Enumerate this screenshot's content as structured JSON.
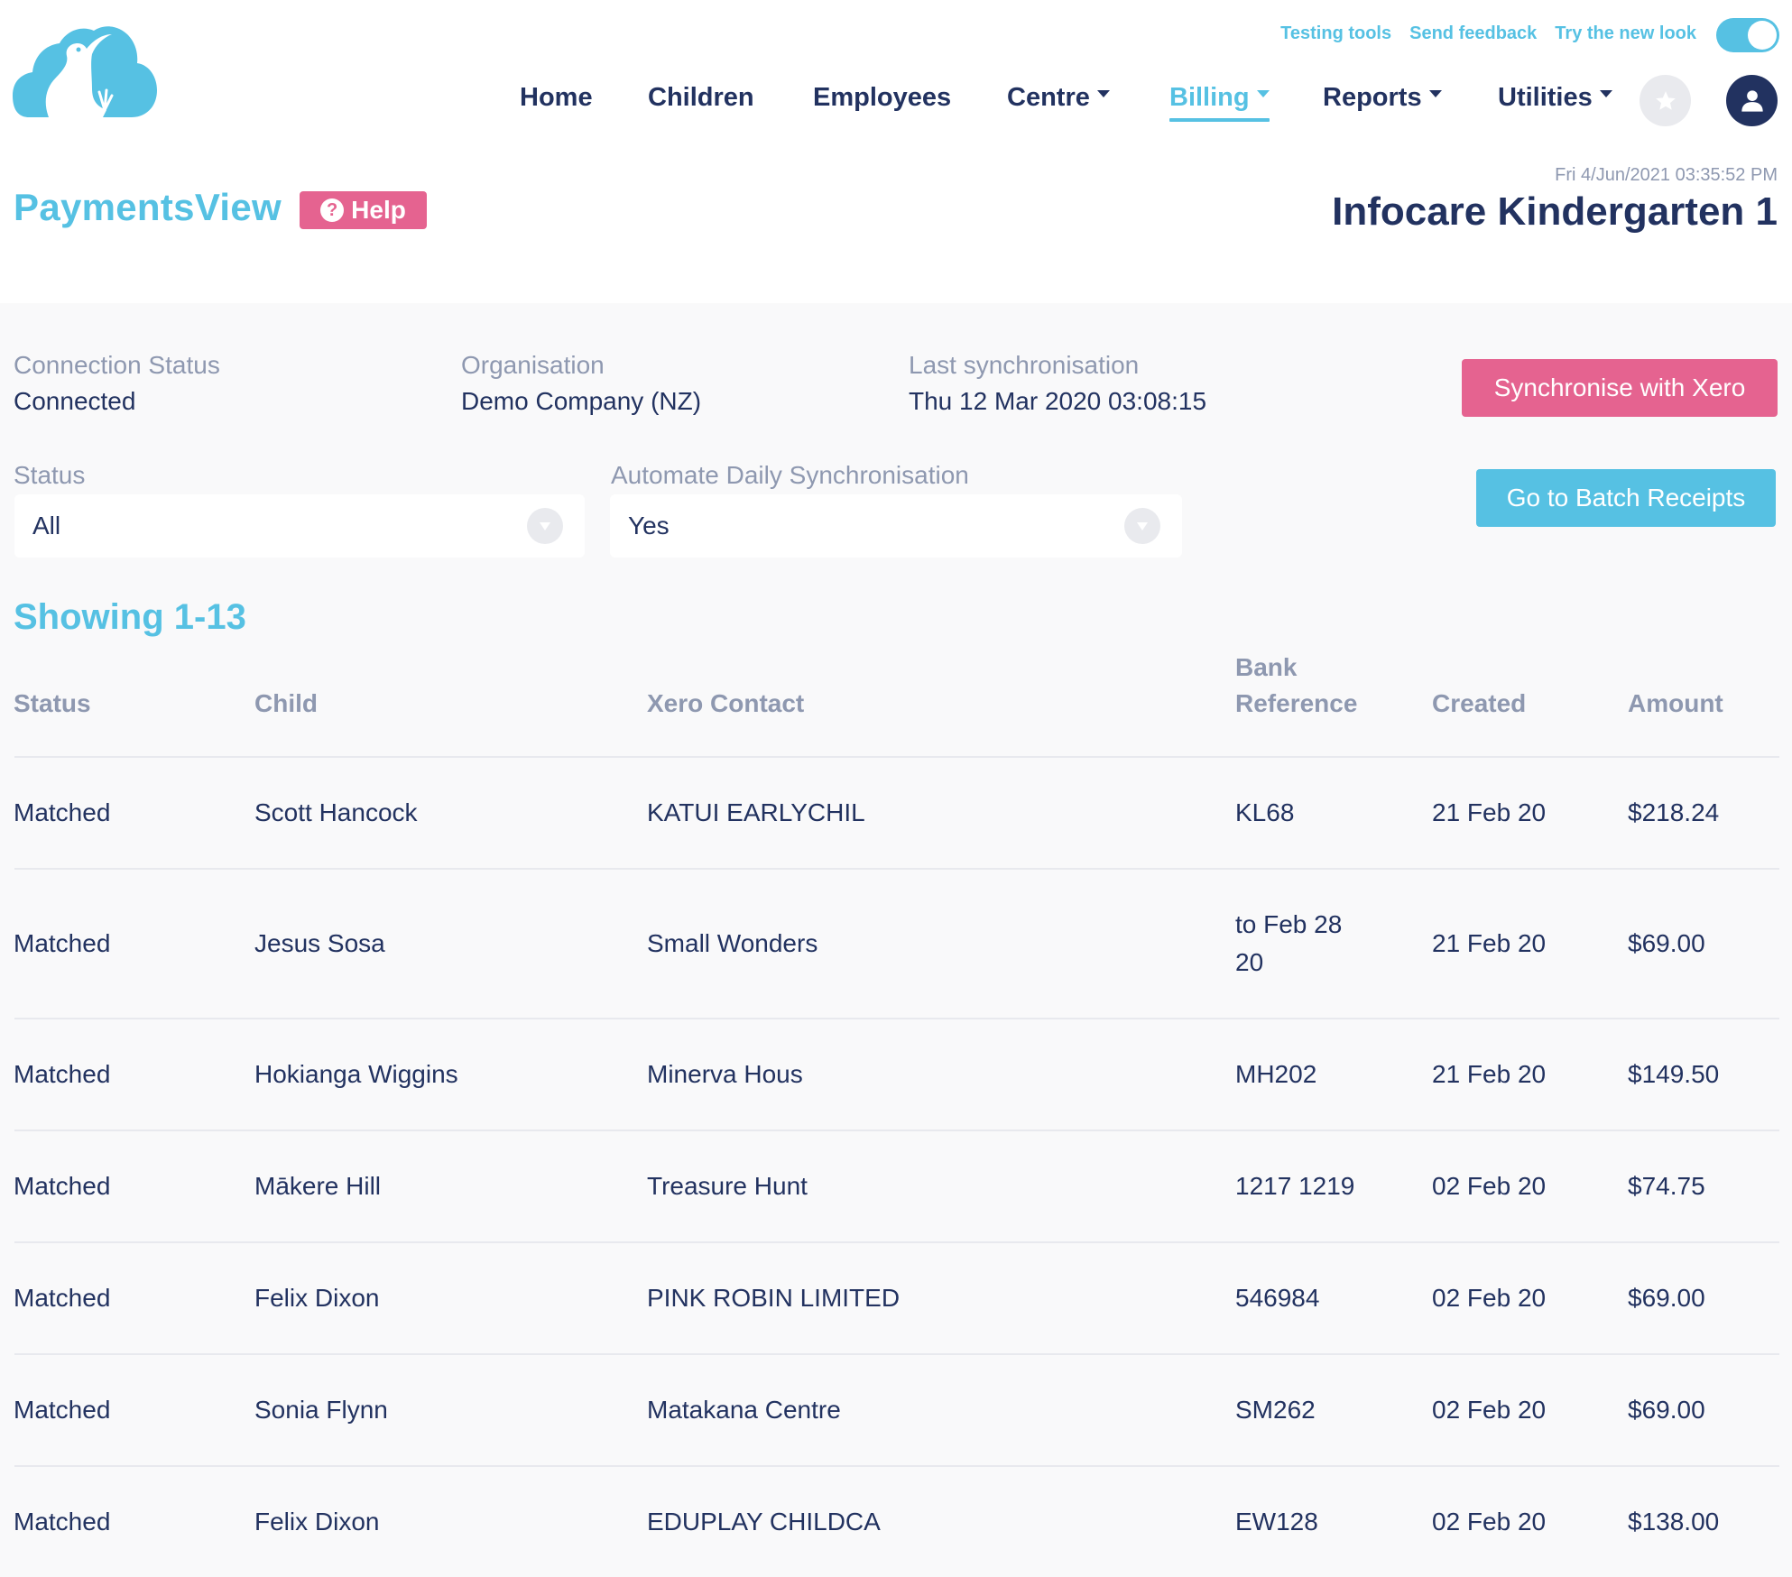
{
  "header": {
    "logo": "kiwi-cloud-logo",
    "top_links": [
      "Testing tools",
      "Send feedback",
      "Try the new look"
    ],
    "new_look_toggle": true,
    "nav": [
      {
        "label": "Home",
        "dropdown": false,
        "active": false
      },
      {
        "label": "Children",
        "dropdown": false,
        "active": false
      },
      {
        "label": "Employees",
        "dropdown": false,
        "active": false
      },
      {
        "label": "Centre",
        "dropdown": true,
        "active": false
      },
      {
        "label": "Billing",
        "dropdown": true,
        "active": true
      },
      {
        "label": "Reports",
        "dropdown": true,
        "active": false
      },
      {
        "label": "Utilities",
        "dropdown": true,
        "active": false
      }
    ],
    "star_icon": "star-icon",
    "user_icon": "user-icon"
  },
  "page": {
    "title": "PaymentsView",
    "help_label": "Help",
    "timestamp": "Fri 4/Jun/2021 03:35:52 PM",
    "centre_name": "Infocare Kindergarten 1"
  },
  "connection": {
    "status_label": "Connection Status",
    "status_value": "Connected",
    "org_label": "Organisation",
    "org_value": "Demo Company (NZ)",
    "sync_label": "Last synchronisation",
    "sync_value": "Thu 12 Mar 2020 03:08:15",
    "sync_button": "Synchronise with Xero",
    "batch_button": "Go to Batch Receipts"
  },
  "filters": {
    "status_label": "Status",
    "status_value": "All",
    "automate_label": "Automate Daily Synchronisation",
    "automate_value": "Yes"
  },
  "table": {
    "showing": "Showing 1-13",
    "columns": [
      "Status",
      "Child",
      "Xero Contact",
      "Bank Reference",
      "Created",
      "Amount"
    ],
    "rows": [
      {
        "status": "Matched",
        "child": "Scott Hancock",
        "contact": "KATUI EARLYCHIL",
        "reference": "KL68",
        "created": "21 Feb 20",
        "amount": "$218.24"
      },
      {
        "status": "Matched",
        "child": "Jesus Sosa",
        "contact": "Small Wonders",
        "reference": "to Feb 28 20",
        "created": "21 Feb 20",
        "amount": "$69.00"
      },
      {
        "status": "Matched",
        "child": "Hokianga Wiggins",
        "contact": "Minerva Hous",
        "reference": "MH202",
        "created": "21 Feb 20",
        "amount": "$149.50"
      },
      {
        "status": "Matched",
        "child": "Mākere Hill",
        "contact": "Treasure Hunt",
        "reference": "1217 1219",
        "created": "02 Feb 20",
        "amount": "$74.75"
      },
      {
        "status": "Matched",
        "child": "Felix Dixon",
        "contact": "PINK ROBIN LIMITED",
        "reference": "546984",
        "created": "02 Feb 20",
        "amount": "$69.00"
      },
      {
        "status": "Matched",
        "child": "Sonia Flynn",
        "contact": "Matakana Centre",
        "reference": "SM262",
        "created": "02 Feb 20",
        "amount": "$69.00"
      },
      {
        "status": "Matched",
        "child": "Felix Dixon",
        "contact": "EDUPLAY CHILDCA",
        "reference": "EW128",
        "created": "02 Feb 20",
        "amount": "$138.00"
      }
    ]
  },
  "colors": {
    "brand_blue": "#56c1e3",
    "brand_pink": "#e56390",
    "navy": "#223260",
    "muted": "#8e98b0"
  }
}
